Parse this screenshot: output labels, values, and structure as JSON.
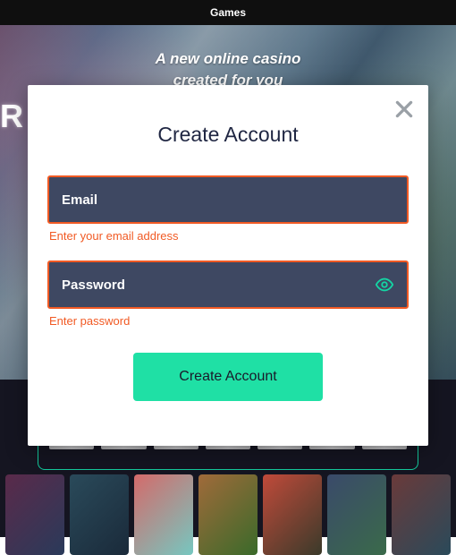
{
  "topbar": {
    "label": "Games"
  },
  "hero": {
    "line1": "A new online casino",
    "line2": "created for you"
  },
  "badge": {
    "letter": "R"
  },
  "modal": {
    "title": "Create Account",
    "email": {
      "label": "Email",
      "value": "",
      "error": "Enter your email address"
    },
    "password": {
      "label": "Password",
      "value": "",
      "error": "Enter password"
    },
    "submit": "Create Account"
  },
  "colors": {
    "accent": "#1fe0a5",
    "error": "#f15a24",
    "field_bg": "#3e4862"
  }
}
